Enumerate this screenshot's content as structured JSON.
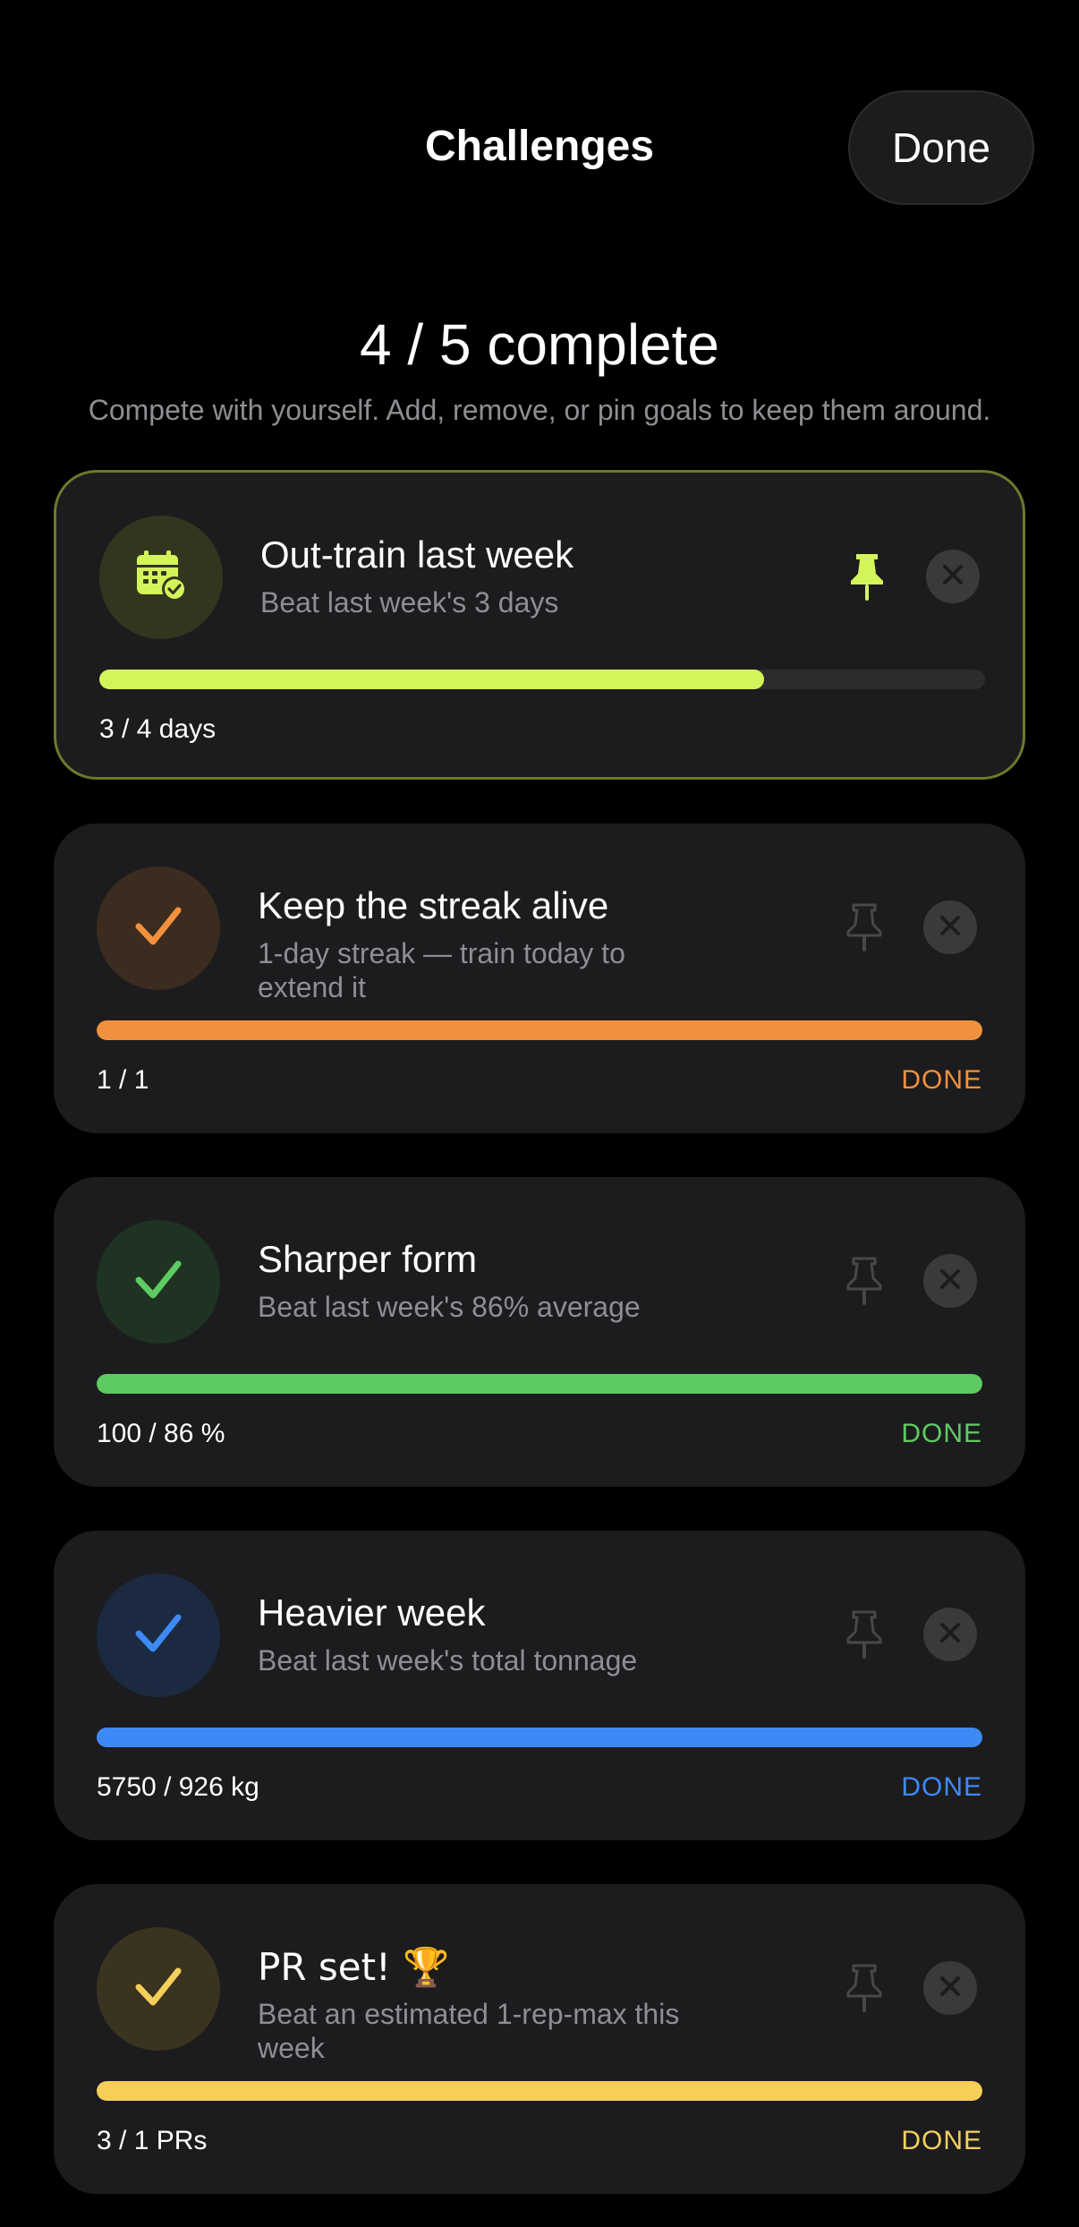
{
  "header": {
    "title": "Challenges",
    "done_label": "Done"
  },
  "summary": {
    "text": "4 / 5 complete",
    "subtitle": "Compete with yourself. Add, remove, or pin goals to keep them around."
  },
  "challenges": [
    {
      "title": "Out-train last week",
      "description": "Beat last week's 3 days",
      "progress_text": "3 / 4 days",
      "progress": 0.75,
      "status": "",
      "pinned": true,
      "icon": "calendar-check-icon",
      "accent": "#d4f55a"
    },
    {
      "title": "Keep the streak alive",
      "description": "1-day streak — train today to extend it",
      "progress_text": "1 / 1",
      "progress": 1.0,
      "status": "DONE",
      "pinned": false,
      "icon": "checkmark-icon",
      "accent": "#f2913d"
    },
    {
      "title": "Sharper form",
      "description": "Beat last week's 86% average",
      "progress_text": "100 / 86 %",
      "progress": 1.0,
      "status": "DONE",
      "pinned": false,
      "icon": "checkmark-icon",
      "accent": "#5ecb62"
    },
    {
      "title": "Heavier week",
      "description": "Beat last week's total tonnage",
      "progress_text": "5750 / 926 kg",
      "progress": 1.0,
      "status": "DONE",
      "pinned": false,
      "icon": "checkmark-icon",
      "accent": "#3d8af7"
    },
    {
      "title": "PR set! 🏆",
      "description": "Beat an estimated 1-rep-max this week",
      "progress_text": "3 / 1 PRs",
      "progress": 1.0,
      "status": "DONE",
      "pinned": false,
      "icon": "checkmark-icon",
      "accent": "#f5cf5a"
    }
  ]
}
